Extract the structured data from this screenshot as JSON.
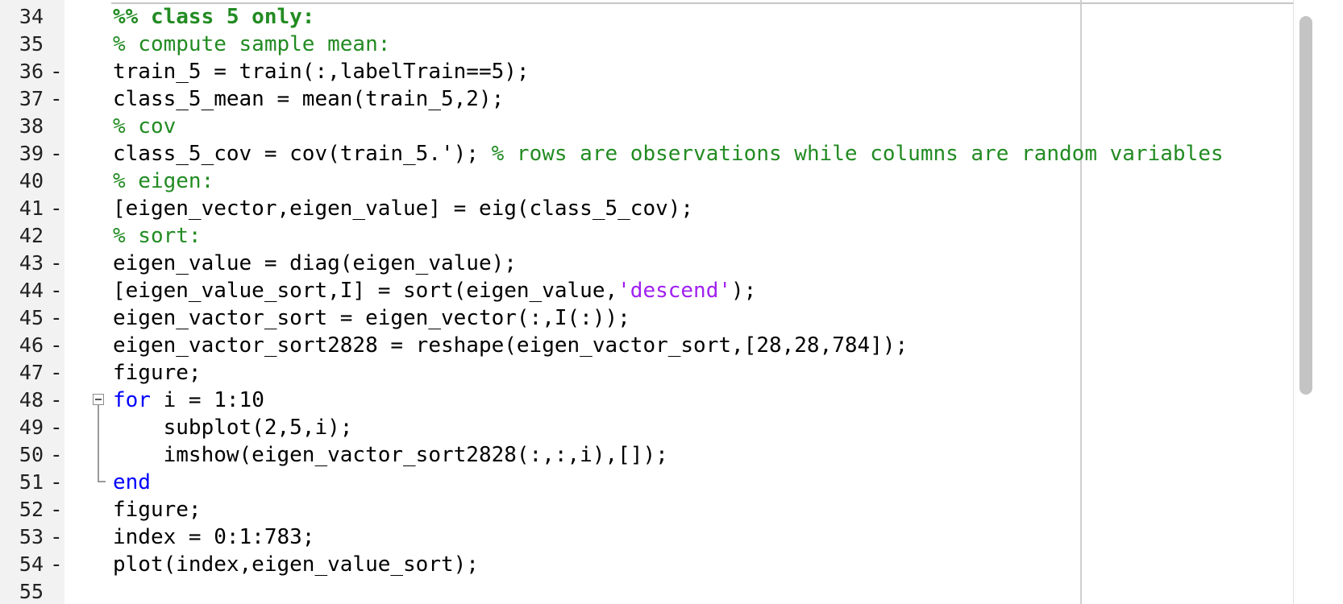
{
  "editor": {
    "colors": {
      "keyword": "#0000ff",
      "comment": "#228b22",
      "string": "#a020f0",
      "text": "#000000",
      "gutter": "#f2f2f2"
    },
    "lines": [
      {
        "num": "34",
        "bp": "",
        "segments": [
          {
            "t": "%% class 5 only:",
            "k": "cell"
          }
        ]
      },
      {
        "num": "35",
        "bp": "",
        "segments": [
          {
            "t": "% compute sample mean:",
            "k": "comment"
          }
        ]
      },
      {
        "num": "36",
        "bp": "-",
        "segments": [
          {
            "t": "train_5 = train(:,labelTrain==5);",
            "k": "normal"
          }
        ]
      },
      {
        "num": "37",
        "bp": "-",
        "segments": [
          {
            "t": "class_5_mean = mean(train_5,2);",
            "k": "normal"
          }
        ]
      },
      {
        "num": "38",
        "bp": "",
        "segments": [
          {
            "t": "% cov",
            "k": "comment"
          }
        ]
      },
      {
        "num": "39",
        "bp": "-",
        "segments": [
          {
            "t": "class_5_cov = cov(train_5.'); ",
            "k": "normal"
          },
          {
            "t": "% rows are observations while columns are random variables",
            "k": "comment"
          }
        ]
      },
      {
        "num": "40",
        "bp": "",
        "segments": [
          {
            "t": "% eigen:",
            "k": "comment"
          }
        ]
      },
      {
        "num": "41",
        "bp": "-",
        "segments": [
          {
            "t": "[eigen_vector,eigen_value] = eig(class_5_cov);",
            "k": "normal"
          }
        ]
      },
      {
        "num": "42",
        "bp": "",
        "segments": [
          {
            "t": "% sort:",
            "k": "comment"
          }
        ]
      },
      {
        "num": "43",
        "bp": "-",
        "segments": [
          {
            "t": "eigen_value = diag(eigen_value);",
            "k": "normal"
          }
        ]
      },
      {
        "num": "44",
        "bp": "-",
        "segments": [
          {
            "t": "[eigen_value_sort,I] = sort(eigen_value,",
            "k": "normal"
          },
          {
            "t": "'descend'",
            "k": "string"
          },
          {
            "t": ");",
            "k": "normal"
          }
        ]
      },
      {
        "num": "45",
        "bp": "-",
        "segments": [
          {
            "t": "eigen_vactor_sort = eigen_vector(:,I(:));",
            "k": "normal"
          }
        ]
      },
      {
        "num": "46",
        "bp": "-",
        "segments": [
          {
            "t": "eigen_vactor_sort2828 = reshape(eigen_vactor_sort,[28,28,784]);",
            "k": "normal"
          }
        ]
      },
      {
        "num": "47",
        "bp": "-",
        "segments": [
          {
            "t": "figure;",
            "k": "normal"
          }
        ]
      },
      {
        "num": "48",
        "bp": "-",
        "segments": [
          {
            "t": "for",
            "k": "keyword"
          },
          {
            "t": " i = 1:10",
            "k": "normal"
          }
        ]
      },
      {
        "num": "49",
        "bp": "-",
        "segments": [
          {
            "t": "    subplot(2,5,i);",
            "k": "normal"
          }
        ]
      },
      {
        "num": "50",
        "bp": "-",
        "segments": [
          {
            "t": "    imshow(eigen_vactor_sort2828(:,:,i),[]);",
            "k": "normal"
          }
        ]
      },
      {
        "num": "51",
        "bp": "-",
        "segments": [
          {
            "t": "end",
            "k": "keyword"
          }
        ]
      },
      {
        "num": "52",
        "bp": "-",
        "segments": [
          {
            "t": "figure;",
            "k": "normal"
          }
        ]
      },
      {
        "num": "53",
        "bp": "-",
        "segments": [
          {
            "t": "index = 0:1:783;",
            "k": "normal"
          }
        ]
      },
      {
        "num": "54",
        "bp": "-",
        "segments": [
          {
            "t": "plot(index,eigen_value_sort);",
            "k": "normal"
          }
        ]
      },
      {
        "num": "55",
        "bp": "",
        "segments": []
      }
    ]
  }
}
